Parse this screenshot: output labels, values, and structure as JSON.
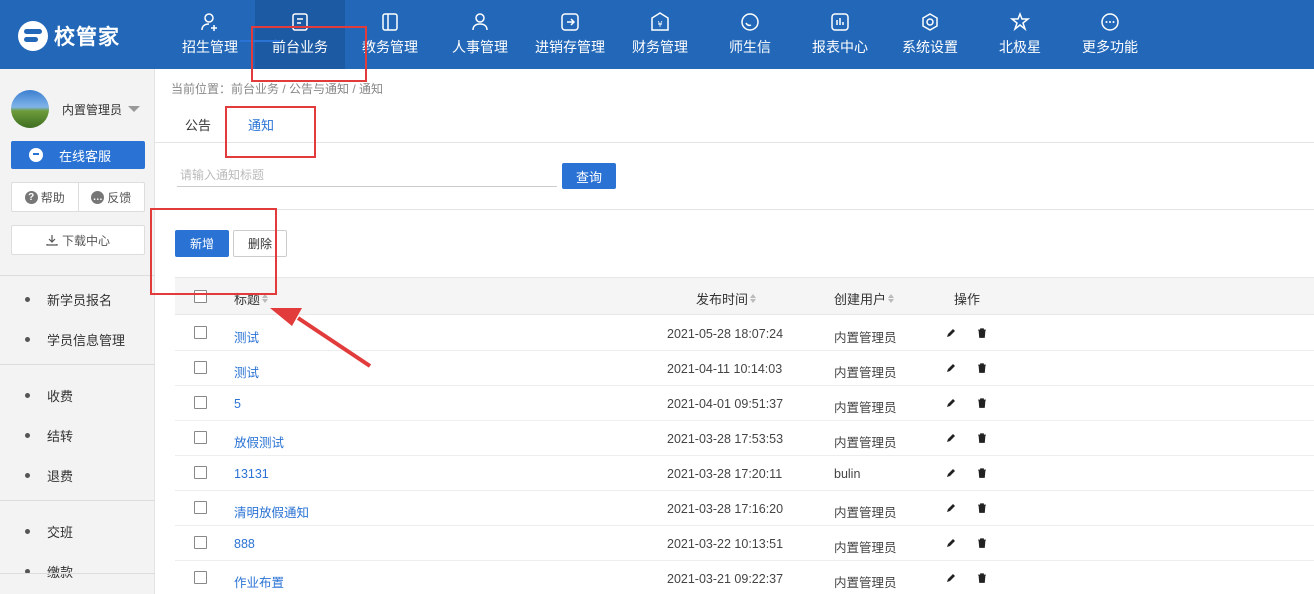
{
  "logo": {
    "text": "校管家"
  },
  "nav": [
    {
      "label": "招生管理",
      "icon": "user-add-icon"
    },
    {
      "label": "前台业务",
      "icon": "document-icon"
    },
    {
      "label": "教务管理",
      "icon": "book-icon"
    },
    {
      "label": "人事管理",
      "icon": "person-icon"
    },
    {
      "label": "进销存管理",
      "icon": "box-arrow-icon"
    },
    {
      "label": "财务管理",
      "icon": "yuan-icon"
    },
    {
      "label": "师生信",
      "icon": "chat-icon"
    },
    {
      "label": "报表中心",
      "icon": "chart-icon"
    },
    {
      "label": "系统设置",
      "icon": "gear-icon"
    },
    {
      "label": "北极星",
      "icon": "star-icon"
    },
    {
      "label": "更多功能",
      "icon": "more-icon"
    }
  ],
  "sidebar": {
    "user_name": "内置管理员",
    "service_label": "在线客服",
    "help_label": "帮助",
    "feedback_label": "反馈",
    "download_label": "下载中心",
    "menu": [
      "新学员报名",
      "学员信息管理",
      "收费",
      "结转",
      "退费",
      "交班",
      "缴款"
    ]
  },
  "breadcrumb": "当前位置：前台业务 / 公告与通知 / 通知",
  "tabs": [
    {
      "label": "公告"
    },
    {
      "label": "通知"
    }
  ],
  "search": {
    "placeholder": "请输入通知标题",
    "query_label": "查询"
  },
  "actions": {
    "add_label": "新增",
    "delete_label": "删除"
  },
  "table": {
    "columns": {
      "title": "标题",
      "time": "发布时间",
      "user": "创建用户",
      "ops": "操作"
    },
    "rows": [
      {
        "title": "测试",
        "time": "2021-05-28 18:07:24",
        "user": "内置管理员"
      },
      {
        "title": "测试",
        "time": "2021-04-11 10:14:03",
        "user": "内置管理员"
      },
      {
        "title": "5",
        "time": "2021-04-01 09:51:37",
        "user": "内置管理员"
      },
      {
        "title": "放假测试",
        "time": "2021-03-28 17:53:53",
        "user": "内置管理员"
      },
      {
        "title": "13131",
        "time": "2021-03-28 17:20:11",
        "user": "bulin"
      },
      {
        "title": "清明放假通知",
        "time": "2021-03-28 17:16:20",
        "user": "内置管理员"
      },
      {
        "title": "888",
        "time": "2021-03-22 10:13:51",
        "user": "内置管理员"
      },
      {
        "title": "作业布置",
        "time": "2021-03-21 09:22:37",
        "user": "内置管理员"
      }
    ]
  },
  "colors": {
    "nav_bg": "#2368b8",
    "accent": "#2a73d4",
    "annotation": "#e23b3b"
  }
}
